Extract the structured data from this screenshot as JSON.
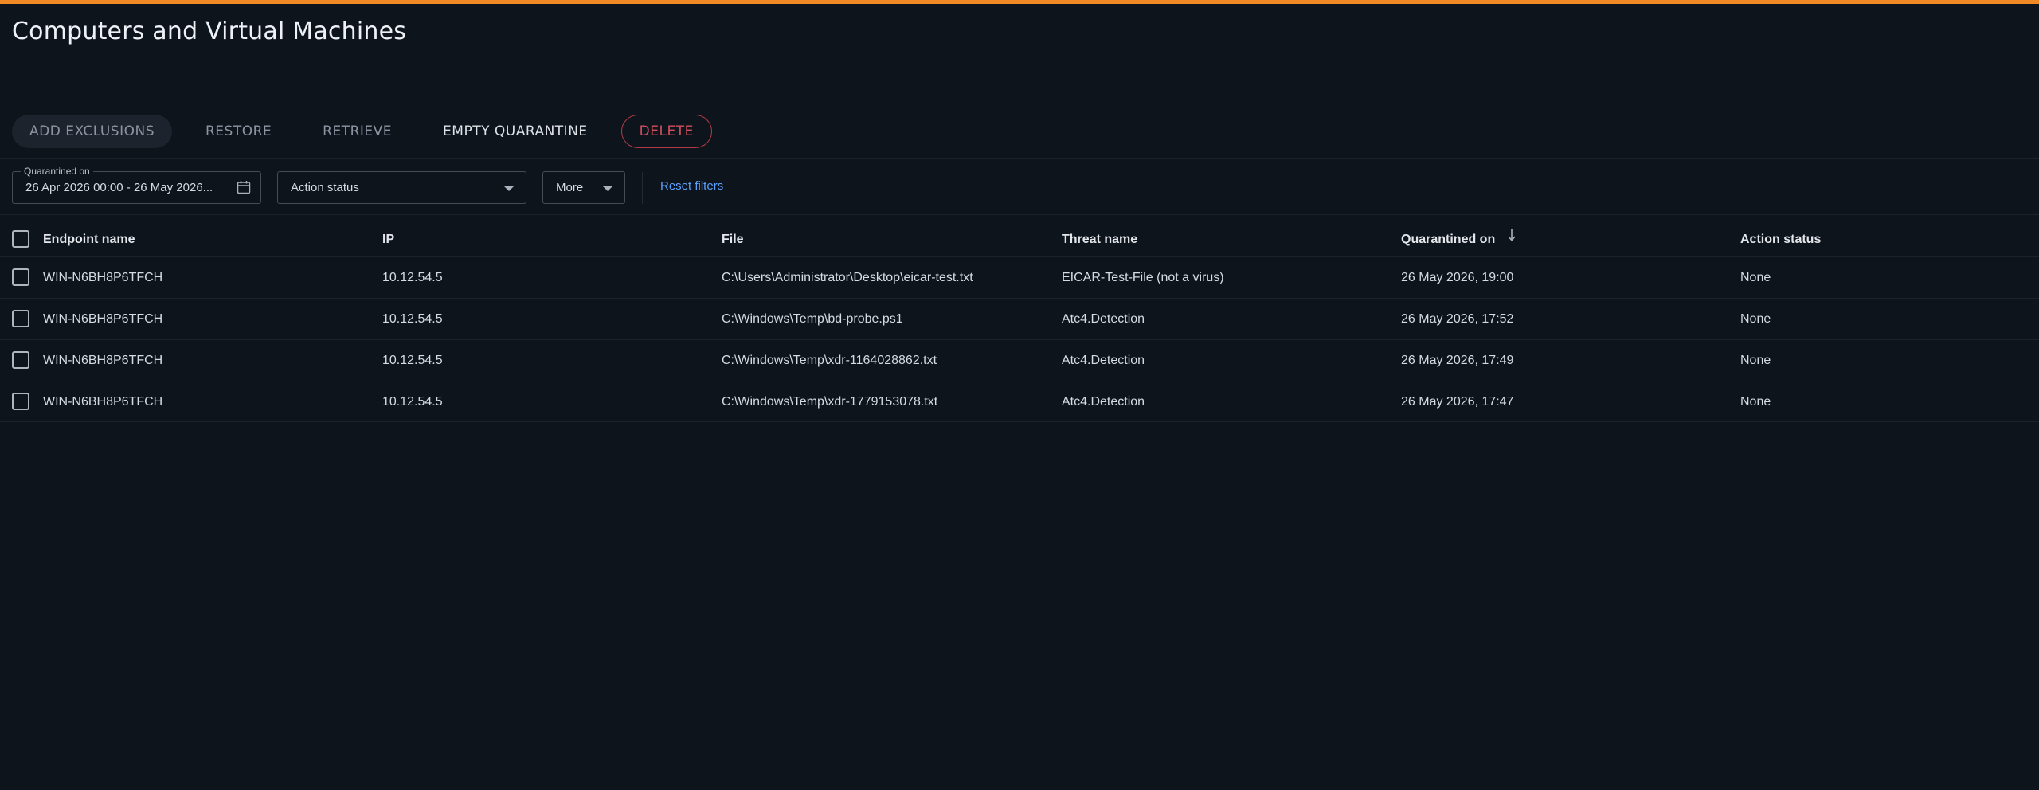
{
  "page": {
    "title": "Computers and Virtual Machines"
  },
  "toolbar": {
    "add_exclusions": "ADD EXCLUSIONS",
    "restore": "RESTORE",
    "retrieve": "RETRIEVE",
    "empty_quarantine": "EMPTY QUARANTINE",
    "delete": "DELETE"
  },
  "filters": {
    "quarantined_on": {
      "label": "Quarantined on",
      "value": "26 Apr 2026 00:00 - 26 May 2026..."
    },
    "action_status": {
      "value": "Action status"
    },
    "more": {
      "value": "More"
    },
    "reset": "Reset filters"
  },
  "table": {
    "columns": [
      "Endpoint name",
      "IP",
      "File",
      "Threat name",
      "Quarantined on",
      "Action status"
    ],
    "sorted_column": "Quarantined on",
    "sort_direction": "descending",
    "rows": [
      {
        "endpoint": "WIN-N6BH8P6TFCH",
        "ip": "10.12.54.5",
        "file": "C:\\Users\\Administrator\\Desktop\\eicar-test.txt",
        "threat": "EICAR-Test-File (not a virus)",
        "quarantined_on": "26 May 2026, 19:00",
        "action_status": "None"
      },
      {
        "endpoint": "WIN-N6BH8P6TFCH",
        "ip": "10.12.54.5",
        "file": "C:\\Windows\\Temp\\bd-probe.ps1",
        "threat": "Atc4.Detection",
        "quarantined_on": "26 May 2026, 17:52",
        "action_status": "None"
      },
      {
        "endpoint": "WIN-N6BH8P6TFCH",
        "ip": "10.12.54.5",
        "file": "C:\\Windows\\Temp\\xdr-1164028862.txt",
        "threat": "Atc4.Detection",
        "quarantined_on": "26 May 2026, 17:49",
        "action_status": "None"
      },
      {
        "endpoint": "WIN-N6BH8P6TFCH",
        "ip": "10.12.54.5",
        "file": "C:\\Windows\\Temp\\xdr-1779153078.txt",
        "threat": "Atc4.Detection",
        "quarantined_on": "26 May 2026, 17:47",
        "action_status": "None"
      }
    ]
  },
  "colors": {
    "accent_bar": "#f08a24",
    "background": "#0e141c",
    "delete": "#d0505c",
    "link": "#5aa2ff"
  }
}
